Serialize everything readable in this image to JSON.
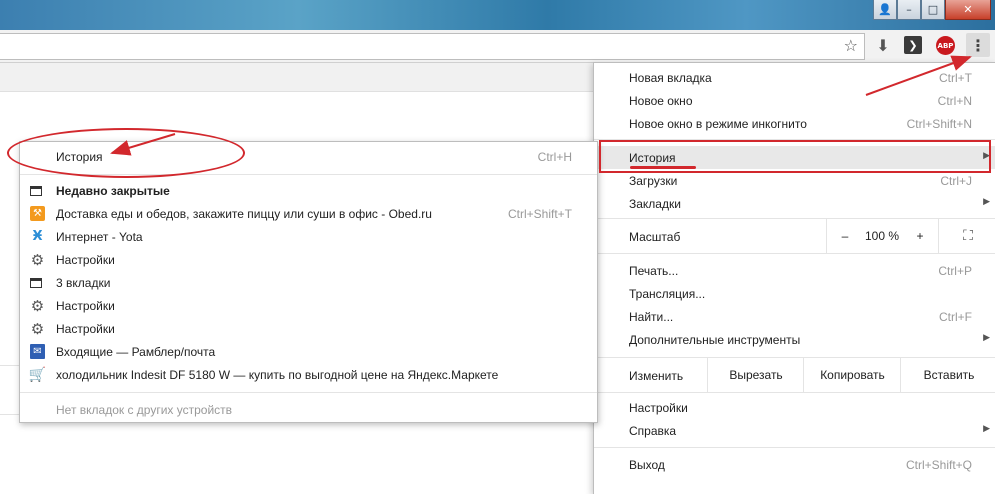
{
  "window": {
    "buttons": {
      "user": "👤",
      "minimize": "–",
      "maximize": "□",
      "close": "✕"
    }
  },
  "toolbar": {
    "star_icon": "☆",
    "download_icon": "⬇",
    "extension_icon": "❯",
    "abp_label": "ABP",
    "menu_icon": "⋮"
  },
  "menu": {
    "new_tab": {
      "label": "Новая вкладка",
      "shortcut": "Ctrl+T"
    },
    "new_window": {
      "label": "Новое окно",
      "shortcut": "Ctrl+N"
    },
    "incognito": {
      "label": "Новое окно в режиме инкогнито",
      "shortcut": "Ctrl+Shift+N"
    },
    "history": {
      "label": "История",
      "arrow": "▶"
    },
    "downloads": {
      "label": "Загрузки",
      "shortcut": "Ctrl+J"
    },
    "bookmarks": {
      "label": "Закладки",
      "arrow": "▶"
    },
    "zoom": {
      "label": "Масштаб",
      "minus": "–",
      "value": "100 %",
      "plus": "+",
      "fullscreen": "⛶"
    },
    "print": {
      "label": "Печать...",
      "shortcut": "Ctrl+P"
    },
    "cast": {
      "label": "Трансляция..."
    },
    "find": {
      "label": "Найти...",
      "shortcut": "Ctrl+F"
    },
    "more_tools": {
      "label": "Дополнительные инструменты",
      "arrow": "▶"
    },
    "edit": {
      "label": "Изменить",
      "cut": "Вырезать",
      "copy": "Копировать",
      "paste": "Вставить"
    },
    "settings": {
      "label": "Настройки"
    },
    "help": {
      "label": "Справка",
      "arrow": "▶"
    },
    "exit": {
      "label": "Выход",
      "shortcut": "Ctrl+Shift+Q"
    }
  },
  "history_submenu": {
    "history": {
      "label": "История",
      "shortcut": "Ctrl+H"
    },
    "recently_closed": "Недавно закрытые",
    "items": [
      {
        "icon": "orange-fork-icon",
        "label": "Доставка еды и обедов, закажите пиццу или суши в офис - Obed.ru",
        "shortcut": "Ctrl+Shift+T"
      },
      {
        "icon": "yota-icon",
        "label": "Интернет - Yota"
      },
      {
        "icon": "gear-icon",
        "label": "Настройки"
      },
      {
        "icon": "tabs-icon",
        "label": "3 вкладки"
      },
      {
        "icon": "gear-icon",
        "label": "Настройки"
      },
      {
        "icon": "gear-icon",
        "label": "Настройки"
      },
      {
        "icon": "mail-icon",
        "label": "Входящие — Рамблер/почта"
      },
      {
        "icon": "cart-icon",
        "label": "холодильник Indesit DF 5180 W — купить по выгодной цене на Яндекс.Маркете"
      }
    ],
    "no_tabs": "Нет вкладок с других устройств"
  },
  "colors": {
    "annotation": "#d2282d",
    "highlight": "#e8e8e8"
  }
}
